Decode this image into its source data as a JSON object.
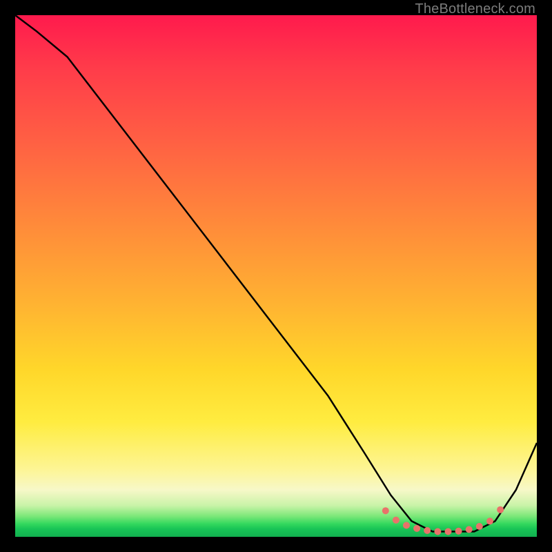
{
  "watermark": "TheBottleneck.com",
  "chart_data": {
    "type": "line",
    "title": "",
    "xlabel": "",
    "ylabel": "",
    "xlim": [
      0,
      100
    ],
    "ylim": [
      0,
      100
    ],
    "series": [
      {
        "name": "curve",
        "x": [
          0,
          4,
          10,
          20,
          30,
          40,
          50,
          60,
          67,
          72,
          76,
          80,
          84,
          88,
          92,
          96,
          100
        ],
        "y": [
          100,
          97,
          92,
          79,
          66,
          53,
          40,
          27,
          16,
          8,
          3,
          1,
          1,
          1,
          3,
          9,
          18
        ]
      }
    ],
    "markers": {
      "name": "flat-region-dots",
      "color": "#e9726a",
      "x": [
        71,
        73,
        75,
        77,
        79,
        81,
        83,
        85,
        87,
        89,
        91,
        93
      ],
      "y": [
        5,
        3.2,
        2.2,
        1.6,
        1.2,
        1.0,
        1.0,
        1.1,
        1.4,
        2.0,
        3.0,
        5.2
      ]
    }
  },
  "colors": {
    "curve": "#000000",
    "marker": "#e9726a"
  }
}
